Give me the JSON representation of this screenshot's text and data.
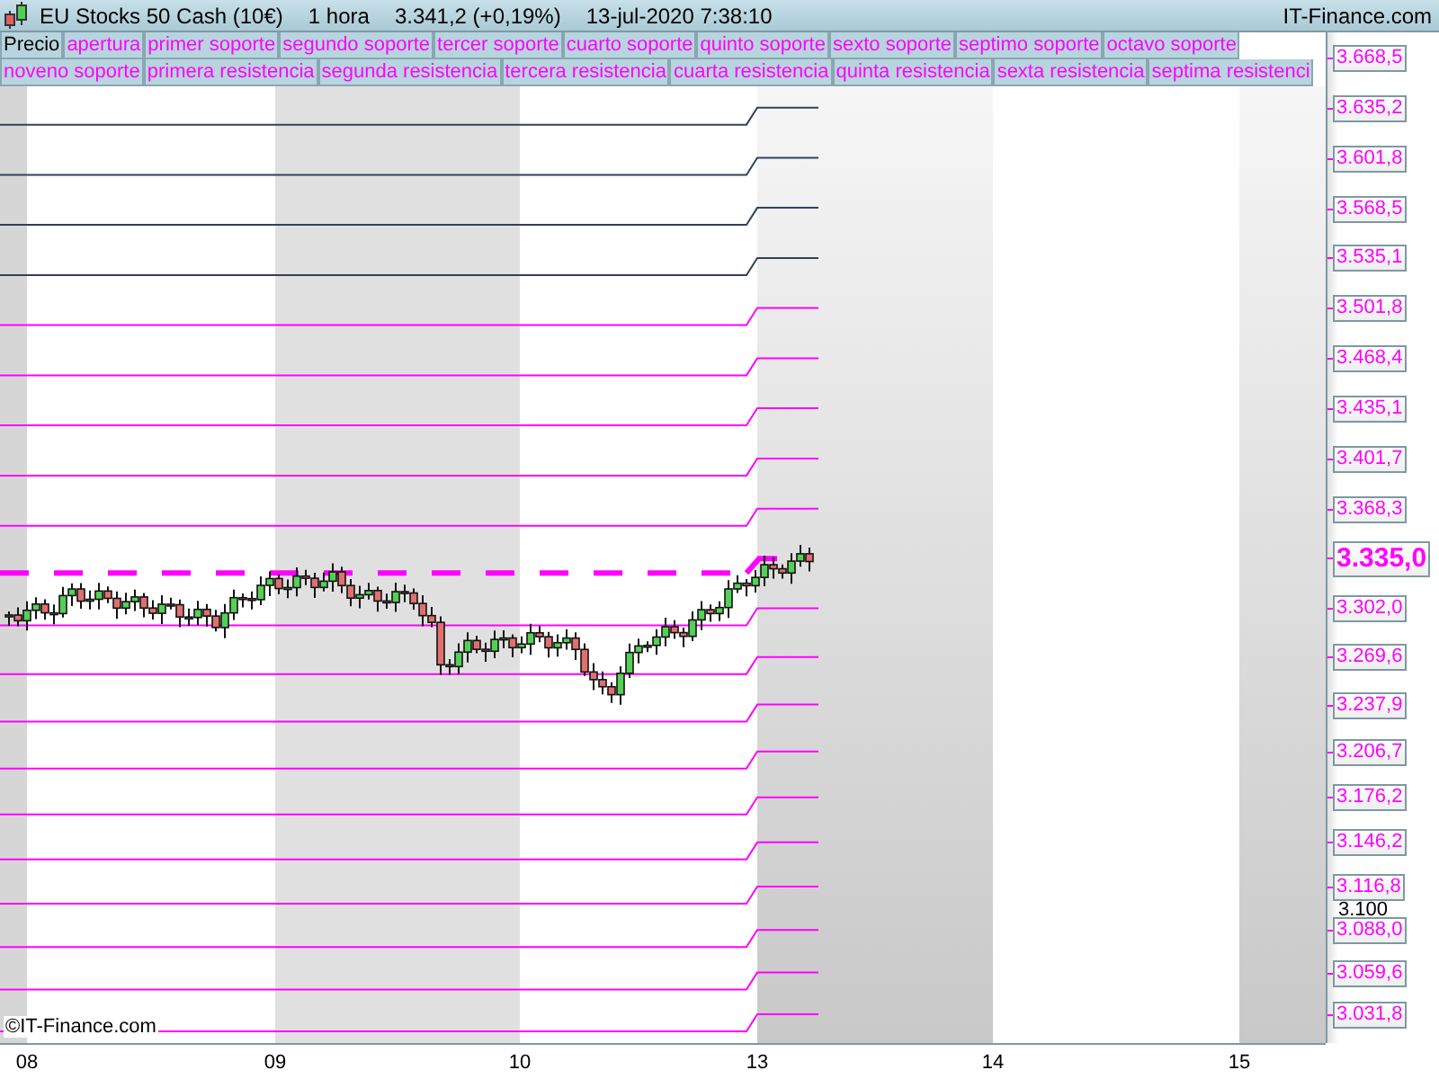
{
  "header": {
    "instrument": "EU Stocks 50 Cash (10€)",
    "timeframe": "1 hora",
    "quote": "3.341,2 (+0,19%)",
    "datetime": "13-jul-2020 7:38:10",
    "brand": "IT-Finance.com"
  },
  "legend": {
    "lines": [
      {
        "items": [
          {
            "label": "Precio",
            "kind": "price"
          },
          {
            "label": "apertura",
            "kind": "level"
          },
          {
            "label": "primer soporte",
            "kind": "level"
          },
          {
            "label": "segundo soporte",
            "kind": "level"
          },
          {
            "label": "tercer soporte",
            "kind": "level"
          },
          {
            "label": "cuarto soporte",
            "kind": "level"
          },
          {
            "label": "quinto soporte",
            "kind": "level"
          },
          {
            "label": "sexto soporte",
            "kind": "level"
          },
          {
            "label": "septimo soporte",
            "kind": "level"
          },
          {
            "label": "octavo soporte",
            "kind": "level"
          }
        ]
      },
      {
        "items": [
          {
            "label": "noveno soporte",
            "kind": "level"
          },
          {
            "label": "primera resistencia",
            "kind": "level"
          },
          {
            "label": "segunda resistencia",
            "kind": "level"
          },
          {
            "label": "tercera resistencia",
            "kind": "level"
          },
          {
            "label": "cuarta resistencia",
            "kind": "level"
          },
          {
            "label": "quinta resistencia",
            "kind": "level"
          },
          {
            "label": "sexta resistencia",
            "kind": "level"
          },
          {
            "label": "septima resistenci",
            "kind": "level"
          }
        ]
      }
    ]
  },
  "price_axis": {
    "labels": [
      {
        "text": "3.668,5",
        "current": false
      },
      {
        "text": "3.635,2",
        "current": false
      },
      {
        "text": "3.601,8",
        "current": false
      },
      {
        "text": "3.568,5",
        "current": false
      },
      {
        "text": "3.535,1",
        "current": false
      },
      {
        "text": "3.501,8",
        "current": false
      },
      {
        "text": "3.468,4",
        "current": false
      },
      {
        "text": "3.435,1",
        "current": false
      },
      {
        "text": "3.401,7",
        "current": false
      },
      {
        "text": "3.368,3",
        "current": false
      },
      {
        "text": "3.335,0",
        "current": true
      },
      {
        "text": "3.302,0",
        "current": false
      },
      {
        "text": "3.269,6",
        "current": false
      },
      {
        "text": "3.237,9",
        "current": false
      },
      {
        "text": "3.206,7",
        "current": false
      },
      {
        "text": "3.176,2",
        "current": false
      },
      {
        "text": "3.146,2",
        "current": false
      },
      {
        "text": "3.116,8",
        "current": false
      },
      {
        "text": "3.088,0",
        "current": false
      },
      {
        "text": "3.059,6",
        "current": false
      },
      {
        "text": "3.031,8",
        "current": false
      }
    ],
    "ticks": [
      "3.100"
    ]
  },
  "time_axis": [
    "08",
    "09",
    "10",
    "13",
    "14",
    "15"
  ],
  "credit": "©IT-Finance.com"
}
